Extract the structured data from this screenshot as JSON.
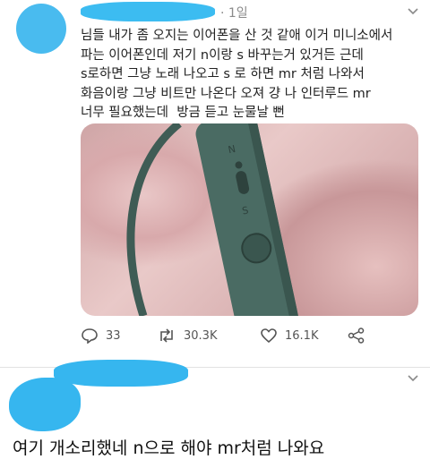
{
  "tweet": {
    "time": "· 1일",
    "text": "님들 내가 좀 오지는 이어폰을 산 것 같애 이거 미니소에서\n파는 이어폰인데 저기 n이랑 s 바꾸는거 있거든 근데\ns로하면 그냥 노래 나오고 s 로 하면 mr 처럼 나와서\n화음이랑 그냥 비트만 나온다 오져 걍 나 인터루드 mr\n너무 필요했는데  방금 듣고 눈물날 뻔",
    "media": {
      "switch_n": "N",
      "switch_s": "S"
    },
    "actions": {
      "replies": "33",
      "retweets": "30.3K",
      "likes": "16.1K"
    }
  },
  "reply": {
    "text": "여기 개소리했네 n으로 해야 mr처럼 나와요"
  },
  "colors": {
    "scribble": "#31b8f0",
    "earphone": "#3f5c55"
  }
}
